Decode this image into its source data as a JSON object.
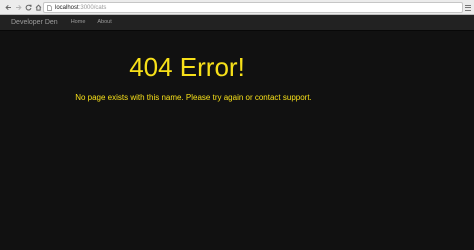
{
  "browser": {
    "url_host": "localhost",
    "url_rest": ":3000/cats",
    "icons": {
      "back": "back-arrow-icon",
      "forward": "forward-arrow-icon",
      "reload": "reload-icon",
      "home": "home-icon",
      "page": "page-icon",
      "menu": "hamburger-menu-icon"
    }
  },
  "navbar": {
    "brand": "Developer Den",
    "links": [
      "Home",
      "About"
    ]
  },
  "main": {
    "title": "404 Error!",
    "message": "No page exists with this name. Please try again or contact support."
  },
  "colors": {
    "accent_text": "#f7e019",
    "page_background": "#111111",
    "navbar_background": "#222222",
    "navbar_text": "#9d9d9d"
  }
}
